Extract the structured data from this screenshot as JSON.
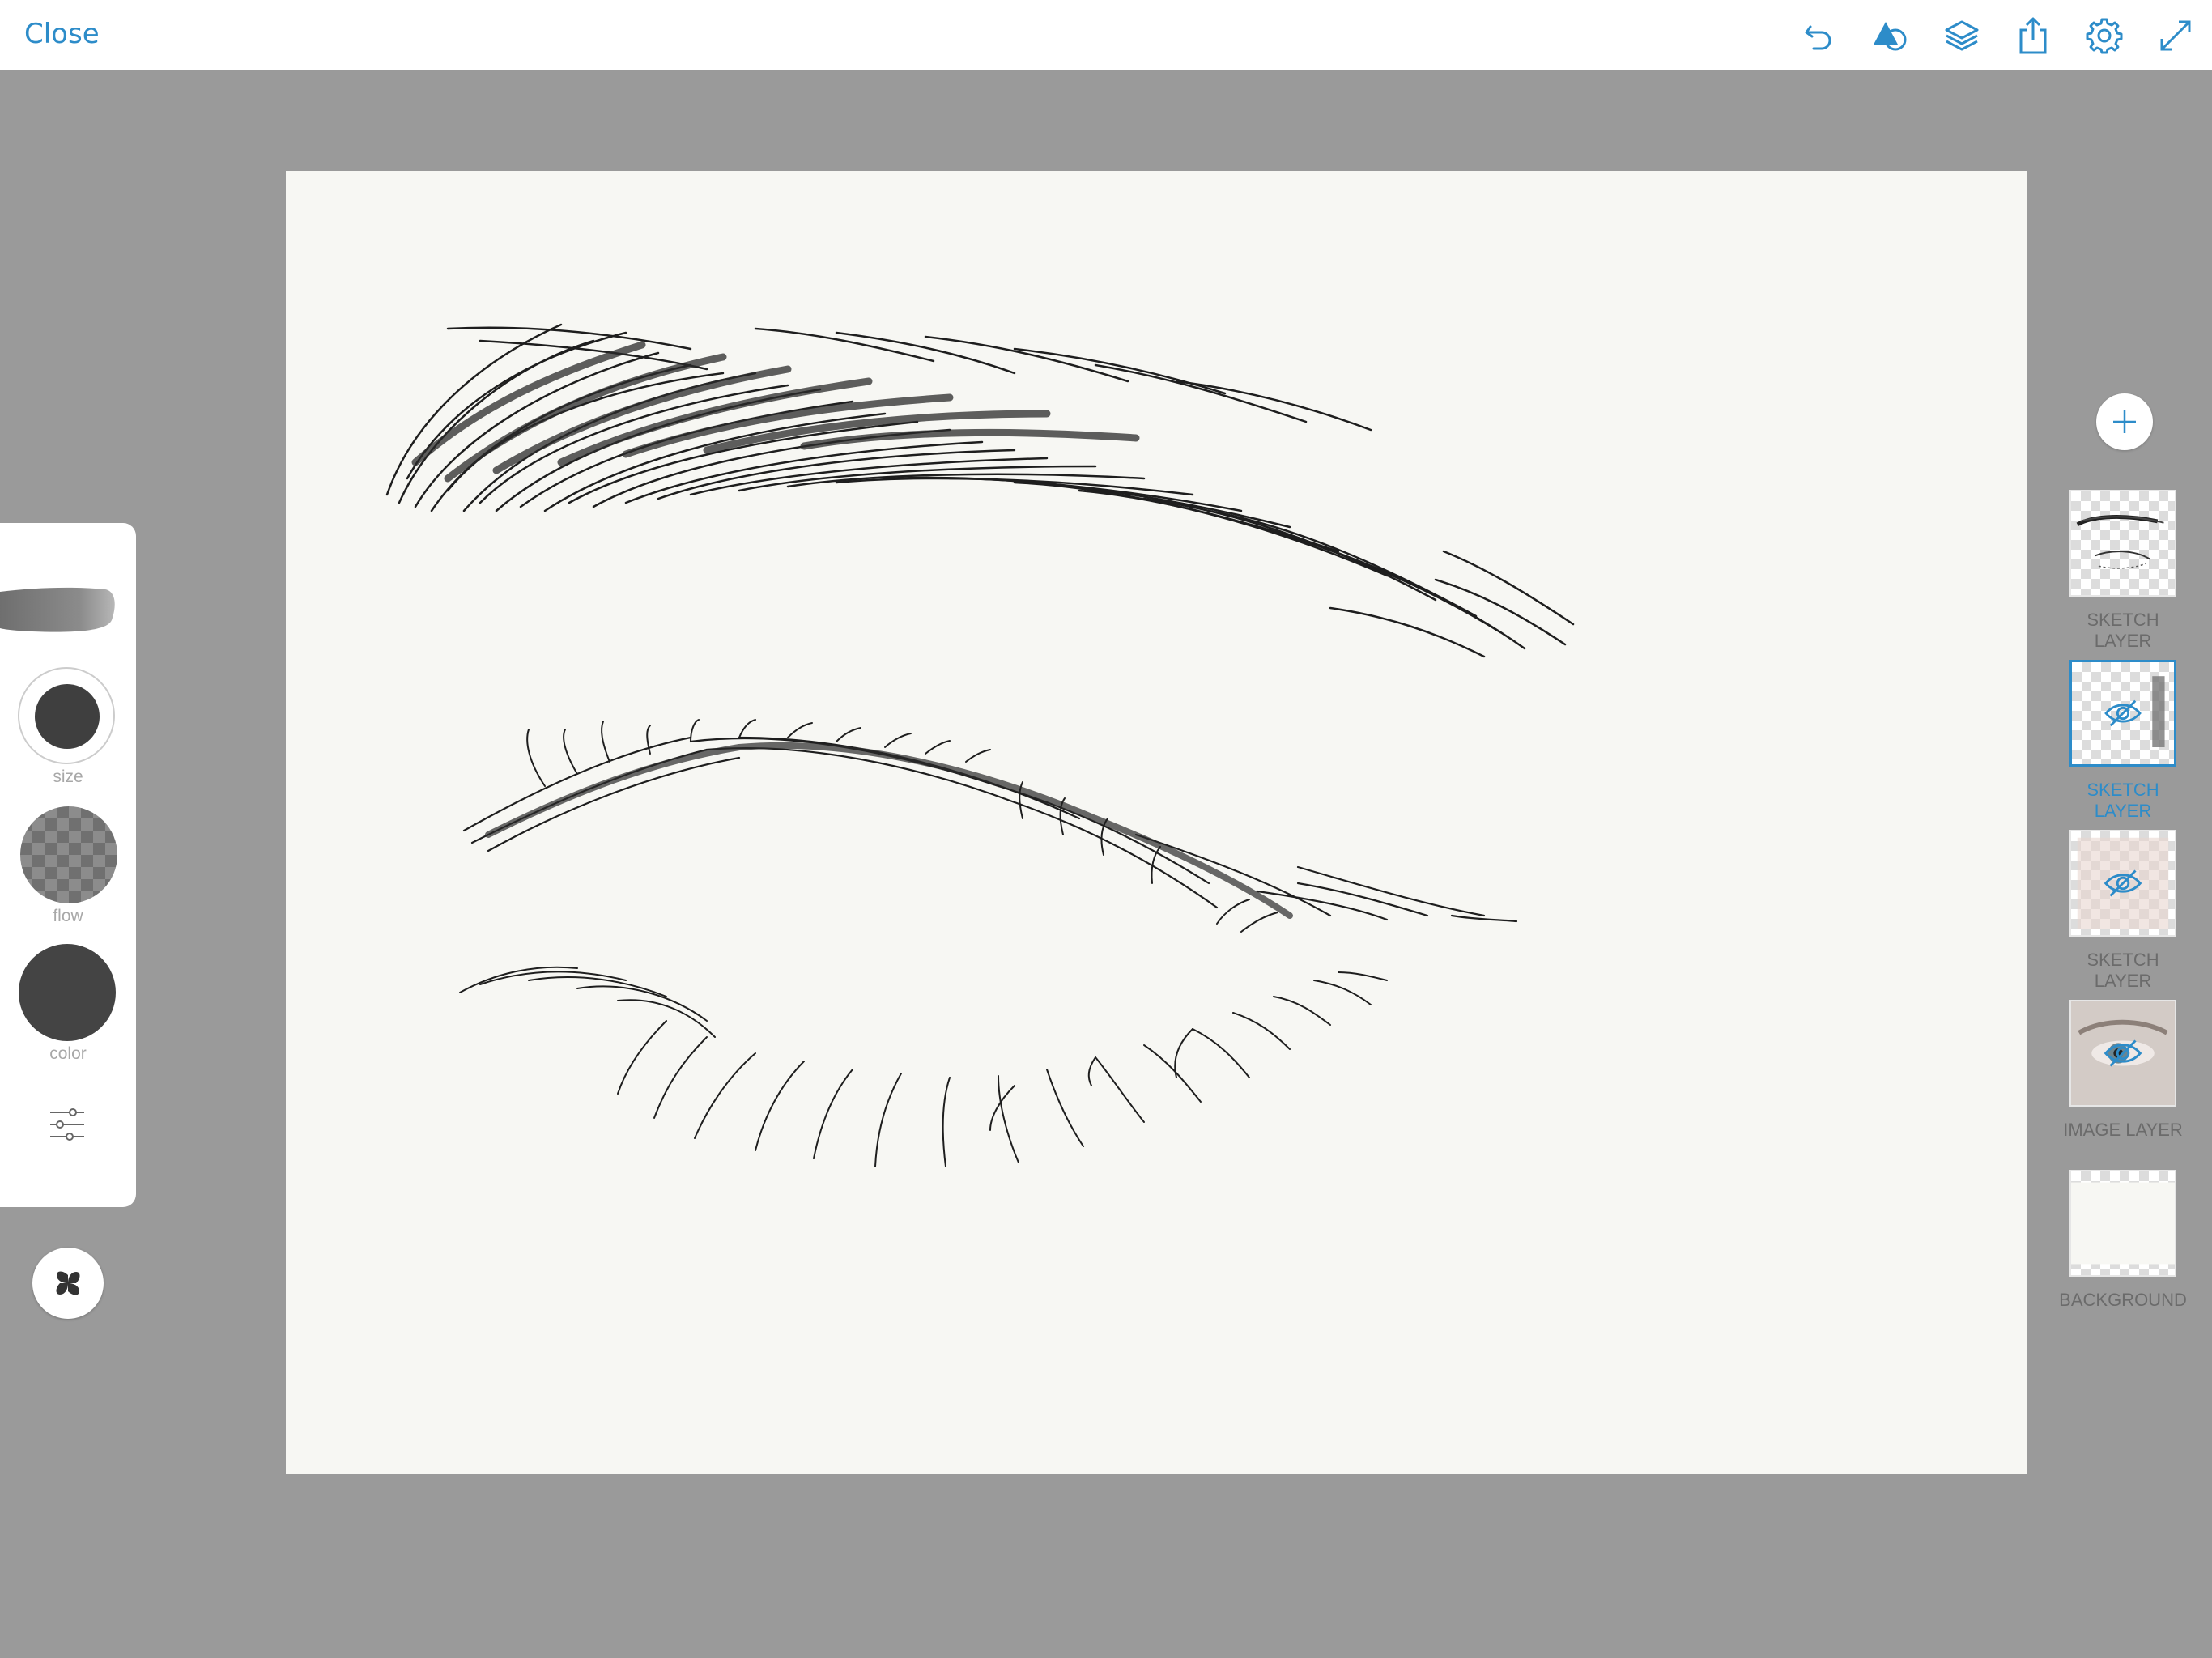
{
  "topbar": {
    "close_label": "Close",
    "icons": [
      "undo-icon",
      "shapes-icon",
      "layers-icon",
      "share-icon",
      "settings-icon",
      "fullscreen-icon"
    ]
  },
  "brush_panel": {
    "size_label": "size",
    "flow_label": "flow",
    "color_label": "color",
    "color_value": "#444444"
  },
  "layers": [
    {
      "label": "SKETCH LAYER",
      "selected": false,
      "hidden": false
    },
    {
      "label": "SKETCH LAYER",
      "selected": true,
      "hidden": true
    },
    {
      "label": "SKETCH LAYER",
      "selected": false,
      "hidden": true
    },
    {
      "label": "IMAGE LAYER",
      "selected": false,
      "hidden": true
    },
    {
      "label": "BACKGROUND",
      "selected": false,
      "hidden": false
    }
  ],
  "colors": {
    "accent": "#2d8cc9",
    "workspace": "#9a9a9a",
    "canvas": "#f7f7f3"
  }
}
